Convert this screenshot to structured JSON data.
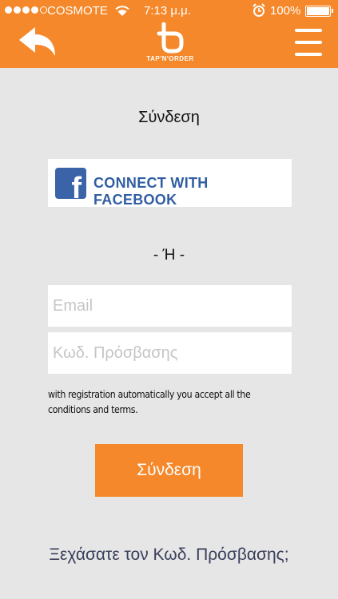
{
  "status_bar": {
    "carrier": "COSMOTE",
    "time": "7:13 μ.μ.",
    "battery": "100%",
    "signal_bars_filled": 4,
    "signal_bars_total": 5
  },
  "header": {
    "logo_text": "TAP'N'ORDER",
    "back_icon": "back-arrow-icon",
    "menu_icon": "hamburger-menu-icon",
    "color": "#f5882a"
  },
  "login": {
    "title": "Σύνδεση",
    "facebook_button": "CONNECT WITH FACEBOOK",
    "separator": "- Ή -",
    "email_placeholder": "Email",
    "password_placeholder": "Κωδ. Πρόσβασης",
    "terms": "with registration automatically you accept all the conditions and terms.",
    "submit": "Σύνδεση",
    "forgot": "Ξεχάσατε τον Κωδ. Πρόσβασης;"
  }
}
